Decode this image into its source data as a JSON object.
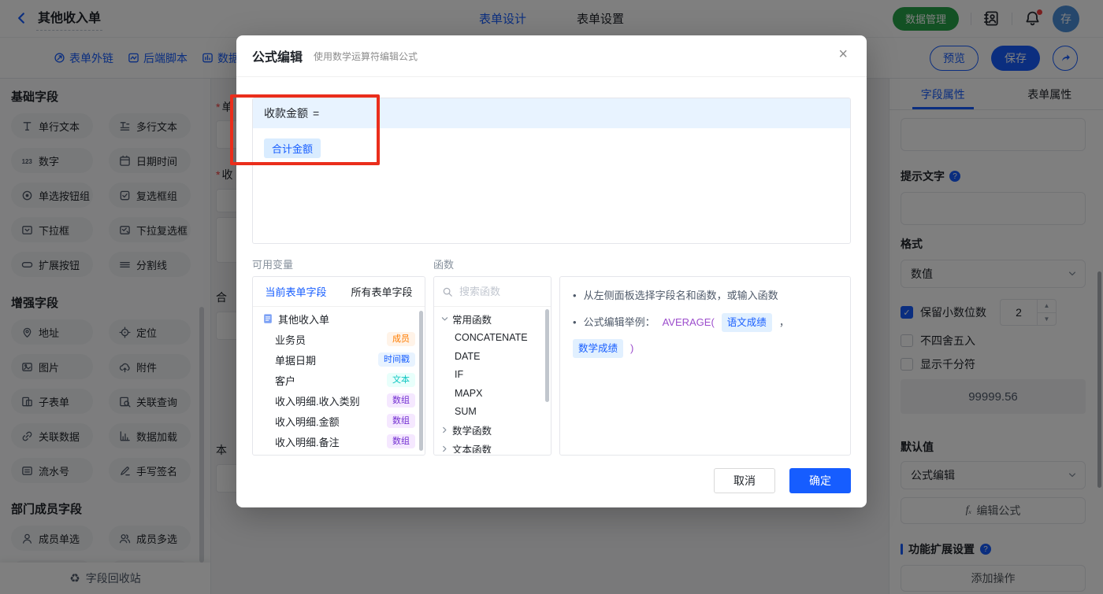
{
  "colors": {
    "primary": "#165dff",
    "green": "#27a249",
    "avatar": "#4b8fd8",
    "annotation": "#ea2e1c",
    "fn-purple": "#9c4dcc",
    "star": "#f53f3f",
    "badge-member-c": "#ff7d00",
    "badge-member-bg": "#fff3e8",
    "badge-timestamp-c": "#165dff",
    "badge-timestamp-bg": "#e8f3ff",
    "badge-text-c": "#0fc6c2",
    "badge-text-bg": "#e8fffb",
    "badge-array-c": "#722ed1",
    "badge-array-bg": "#f5e8ff"
  },
  "header": {
    "title": "其他收入单",
    "tabs": [
      {
        "label": "表单设计"
      },
      {
        "label": "表单设置"
      }
    ],
    "data_manage": "数据管理",
    "avatar": "存"
  },
  "toolbar": {
    "links": [
      {
        "icon": "link-icon",
        "label": "表单外链"
      },
      {
        "icon": "script-icon",
        "label": "后端脚本"
      },
      {
        "icon": "perm-icon",
        "label": "数据权"
      }
    ],
    "preview": "预览",
    "save": "保存"
  },
  "sidebar": {
    "sections": [
      {
        "title": "基础字段",
        "items": [
          {
            "icon": "text-single-icon",
            "label": "单行文本"
          },
          {
            "icon": "text-multi-icon",
            "label": "多行文本"
          },
          {
            "icon": "number-icon",
            "label": "数字"
          },
          {
            "icon": "datetime-icon",
            "label": "日期时间"
          },
          {
            "icon": "radio-group-icon",
            "label": "单选按钮组"
          },
          {
            "icon": "checkbox-group-icon",
            "label": "复选框组"
          },
          {
            "icon": "select-icon",
            "label": "下拉框"
          },
          {
            "icon": "multiselect-icon",
            "label": "下拉复选框"
          },
          {
            "icon": "extend-button-icon",
            "label": "扩展按钮"
          },
          {
            "icon": "divider-icon",
            "label": "分割线"
          }
        ]
      },
      {
        "title": "增强字段",
        "items": [
          {
            "icon": "address-icon",
            "label": "地址"
          },
          {
            "icon": "location-icon",
            "label": "定位"
          },
          {
            "icon": "image-icon",
            "label": "图片"
          },
          {
            "icon": "attachment-icon",
            "label": "附件"
          },
          {
            "icon": "subform-icon",
            "label": "子表单"
          },
          {
            "icon": "lookup-icon",
            "label": "关联查询"
          },
          {
            "icon": "linked-data-icon",
            "label": "关联数据"
          },
          {
            "icon": "data-load-icon",
            "label": "数据加载"
          },
          {
            "icon": "serial-icon",
            "label": "流水号"
          },
          {
            "icon": "signature-icon",
            "label": "手写签名"
          }
        ]
      },
      {
        "title": "部门成员字段",
        "clipped_row": true,
        "items": [
          {
            "icon": "member-single-icon",
            "label": "成员单选"
          },
          {
            "icon": "member-multi-icon",
            "label": "成员多选"
          }
        ]
      }
    ],
    "recycle": "字段回收站"
  },
  "canvas": {
    "required_mark": "*",
    "fields": [
      {
        "label": "单",
        "required": true
      },
      {
        "label": "收",
        "required": true
      },
      {
        "label": "合",
        "required": false
      },
      {
        "label": "本",
        "required": false
      }
    ]
  },
  "modal": {
    "title": "公式编辑",
    "subtitle": "使用数学运算符编辑公式",
    "formula": {
      "target": "收款金额",
      "equals": "=",
      "token": "合计金额"
    },
    "variables": {
      "label": "可用变量",
      "tabs": [
        {
          "label": "当前表单字段"
        },
        {
          "label": "所有表单字段"
        }
      ],
      "root": "其他收入单",
      "fields": [
        {
          "name": "业务员",
          "type": "成员"
        },
        {
          "name": "单据日期",
          "type": "时间戳"
        },
        {
          "name": "客户",
          "type": "文本"
        },
        {
          "name": "收入明细.收入类别",
          "type": "数组"
        },
        {
          "name": "收入明细.金额",
          "type": "数组"
        },
        {
          "name": "收入明细.备注",
          "type": "数组"
        }
      ],
      "partial_field_type": "成员"
    },
    "functions": {
      "label": "函数",
      "search_placeholder": "搜索函数",
      "tree": [
        {
          "group": "常用函数",
          "expanded": true,
          "items": [
            "CONCATENATE",
            "DATE",
            "IF",
            "MAPX",
            "SUM"
          ]
        },
        {
          "group": "数学函数",
          "expanded": false,
          "items": []
        },
        {
          "group": "文本函数",
          "expanded": false,
          "items": []
        }
      ]
    },
    "tips": {
      "line1": "从左侧面板选择字段名和函数，或输入函数",
      "line2_prefix": "公式编辑举例：",
      "fn_open": "AVERAGE(",
      "arg1": "语文成绩",
      "comma": "，",
      "arg2": "数学成绩",
      "fn_close": ")"
    },
    "cancel": "取消",
    "ok": "确定"
  },
  "right_panel": {
    "tabs": [
      {
        "label": "字段属性"
      },
      {
        "label": "表单属性"
      }
    ],
    "hint_label": "提示文字",
    "format_label": "格式",
    "format_value": "数值",
    "decimal_label": "保留小数位数",
    "decimal_checked": true,
    "decimal_value": "2",
    "no_round_label": "不四舍五入",
    "no_round_checked": false,
    "thousand_label": "显示千分符",
    "thousand_checked": false,
    "preview_value": "99999.56",
    "default_label": "默认值",
    "default_value": "公式编辑",
    "fx_label": "编辑公式",
    "ext_label": "功能扩展设置",
    "add_action": "添加操作"
  }
}
